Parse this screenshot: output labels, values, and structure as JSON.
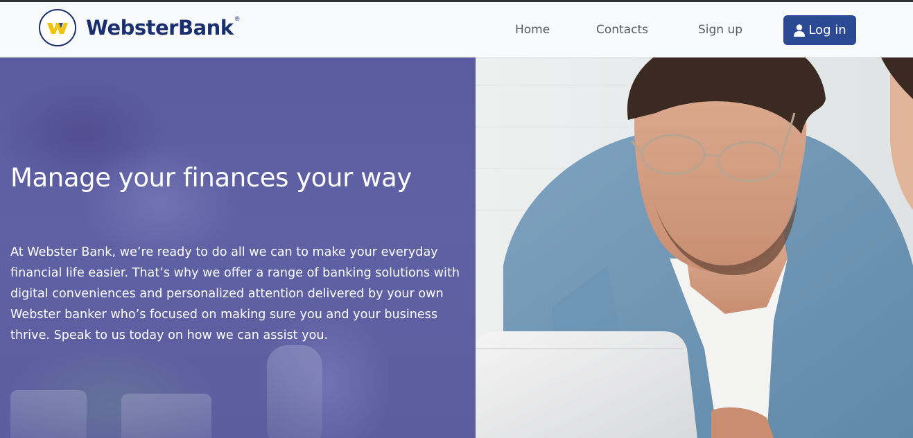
{
  "brand": {
    "name": "WebsterBank",
    "colors": {
      "navy": "#1a2f6e",
      "gold": "#f2c40f",
      "button": "#2c4a93",
      "hero_overlay": "#5c5ea2"
    }
  },
  "nav": {
    "items": [
      "Home",
      "Contacts",
      "Sign up"
    ],
    "login": {
      "icon": "user-icon",
      "label": "Log in"
    }
  },
  "hero": {
    "title": "Manage your finances your way",
    "body": "At Webster Bank, we’re ready to do all we can to make your everyday financial life easier. That’s why we offer a range of banking solutions with digital conveniences and personalized attention delivered by your own Webster banker who’s focused on making sure you and your business thrive. Speak to us today on how we can assist you.",
    "image": "photo-man-glasses-laptop"
  }
}
